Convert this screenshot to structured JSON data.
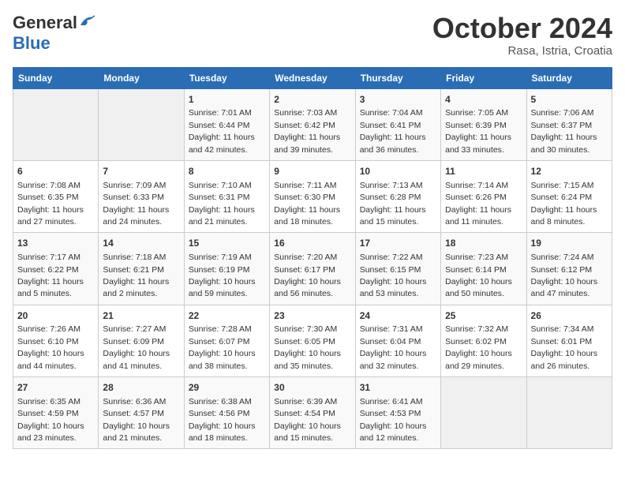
{
  "header": {
    "logo_general": "General",
    "logo_blue": "Blue",
    "month_title": "October 2024",
    "location": "Rasa, Istria, Croatia"
  },
  "days_of_week": [
    "Sunday",
    "Monday",
    "Tuesday",
    "Wednesday",
    "Thursday",
    "Friday",
    "Saturday"
  ],
  "weeks": [
    [
      {
        "day": "",
        "info": ""
      },
      {
        "day": "",
        "info": ""
      },
      {
        "day": "1",
        "info": "Sunrise: 7:01 AM\nSunset: 6:44 PM\nDaylight: 11 hours and 42 minutes."
      },
      {
        "day": "2",
        "info": "Sunrise: 7:03 AM\nSunset: 6:42 PM\nDaylight: 11 hours and 39 minutes."
      },
      {
        "day": "3",
        "info": "Sunrise: 7:04 AM\nSunset: 6:41 PM\nDaylight: 11 hours and 36 minutes."
      },
      {
        "day": "4",
        "info": "Sunrise: 7:05 AM\nSunset: 6:39 PM\nDaylight: 11 hours and 33 minutes."
      },
      {
        "day": "5",
        "info": "Sunrise: 7:06 AM\nSunset: 6:37 PM\nDaylight: 11 hours and 30 minutes."
      }
    ],
    [
      {
        "day": "6",
        "info": "Sunrise: 7:08 AM\nSunset: 6:35 PM\nDaylight: 11 hours and 27 minutes."
      },
      {
        "day": "7",
        "info": "Sunrise: 7:09 AM\nSunset: 6:33 PM\nDaylight: 11 hours and 24 minutes."
      },
      {
        "day": "8",
        "info": "Sunrise: 7:10 AM\nSunset: 6:31 PM\nDaylight: 11 hours and 21 minutes."
      },
      {
        "day": "9",
        "info": "Sunrise: 7:11 AM\nSunset: 6:30 PM\nDaylight: 11 hours and 18 minutes."
      },
      {
        "day": "10",
        "info": "Sunrise: 7:13 AM\nSunset: 6:28 PM\nDaylight: 11 hours and 15 minutes."
      },
      {
        "day": "11",
        "info": "Sunrise: 7:14 AM\nSunset: 6:26 PM\nDaylight: 11 hours and 11 minutes."
      },
      {
        "day": "12",
        "info": "Sunrise: 7:15 AM\nSunset: 6:24 PM\nDaylight: 11 hours and 8 minutes."
      }
    ],
    [
      {
        "day": "13",
        "info": "Sunrise: 7:17 AM\nSunset: 6:22 PM\nDaylight: 11 hours and 5 minutes."
      },
      {
        "day": "14",
        "info": "Sunrise: 7:18 AM\nSunset: 6:21 PM\nDaylight: 11 hours and 2 minutes."
      },
      {
        "day": "15",
        "info": "Sunrise: 7:19 AM\nSunset: 6:19 PM\nDaylight: 10 hours and 59 minutes."
      },
      {
        "day": "16",
        "info": "Sunrise: 7:20 AM\nSunset: 6:17 PM\nDaylight: 10 hours and 56 minutes."
      },
      {
        "day": "17",
        "info": "Sunrise: 7:22 AM\nSunset: 6:15 PM\nDaylight: 10 hours and 53 minutes."
      },
      {
        "day": "18",
        "info": "Sunrise: 7:23 AM\nSunset: 6:14 PM\nDaylight: 10 hours and 50 minutes."
      },
      {
        "day": "19",
        "info": "Sunrise: 7:24 AM\nSunset: 6:12 PM\nDaylight: 10 hours and 47 minutes."
      }
    ],
    [
      {
        "day": "20",
        "info": "Sunrise: 7:26 AM\nSunset: 6:10 PM\nDaylight: 10 hours and 44 minutes."
      },
      {
        "day": "21",
        "info": "Sunrise: 7:27 AM\nSunset: 6:09 PM\nDaylight: 10 hours and 41 minutes."
      },
      {
        "day": "22",
        "info": "Sunrise: 7:28 AM\nSunset: 6:07 PM\nDaylight: 10 hours and 38 minutes."
      },
      {
        "day": "23",
        "info": "Sunrise: 7:30 AM\nSunset: 6:05 PM\nDaylight: 10 hours and 35 minutes."
      },
      {
        "day": "24",
        "info": "Sunrise: 7:31 AM\nSunset: 6:04 PM\nDaylight: 10 hours and 32 minutes."
      },
      {
        "day": "25",
        "info": "Sunrise: 7:32 AM\nSunset: 6:02 PM\nDaylight: 10 hours and 29 minutes."
      },
      {
        "day": "26",
        "info": "Sunrise: 7:34 AM\nSunset: 6:01 PM\nDaylight: 10 hours and 26 minutes."
      }
    ],
    [
      {
        "day": "27",
        "info": "Sunrise: 6:35 AM\nSunset: 4:59 PM\nDaylight: 10 hours and 23 minutes."
      },
      {
        "day": "28",
        "info": "Sunrise: 6:36 AM\nSunset: 4:57 PM\nDaylight: 10 hours and 21 minutes."
      },
      {
        "day": "29",
        "info": "Sunrise: 6:38 AM\nSunset: 4:56 PM\nDaylight: 10 hours and 18 minutes."
      },
      {
        "day": "30",
        "info": "Sunrise: 6:39 AM\nSunset: 4:54 PM\nDaylight: 10 hours and 15 minutes."
      },
      {
        "day": "31",
        "info": "Sunrise: 6:41 AM\nSunset: 4:53 PM\nDaylight: 10 hours and 12 minutes."
      },
      {
        "day": "",
        "info": ""
      },
      {
        "day": "",
        "info": ""
      }
    ]
  ]
}
